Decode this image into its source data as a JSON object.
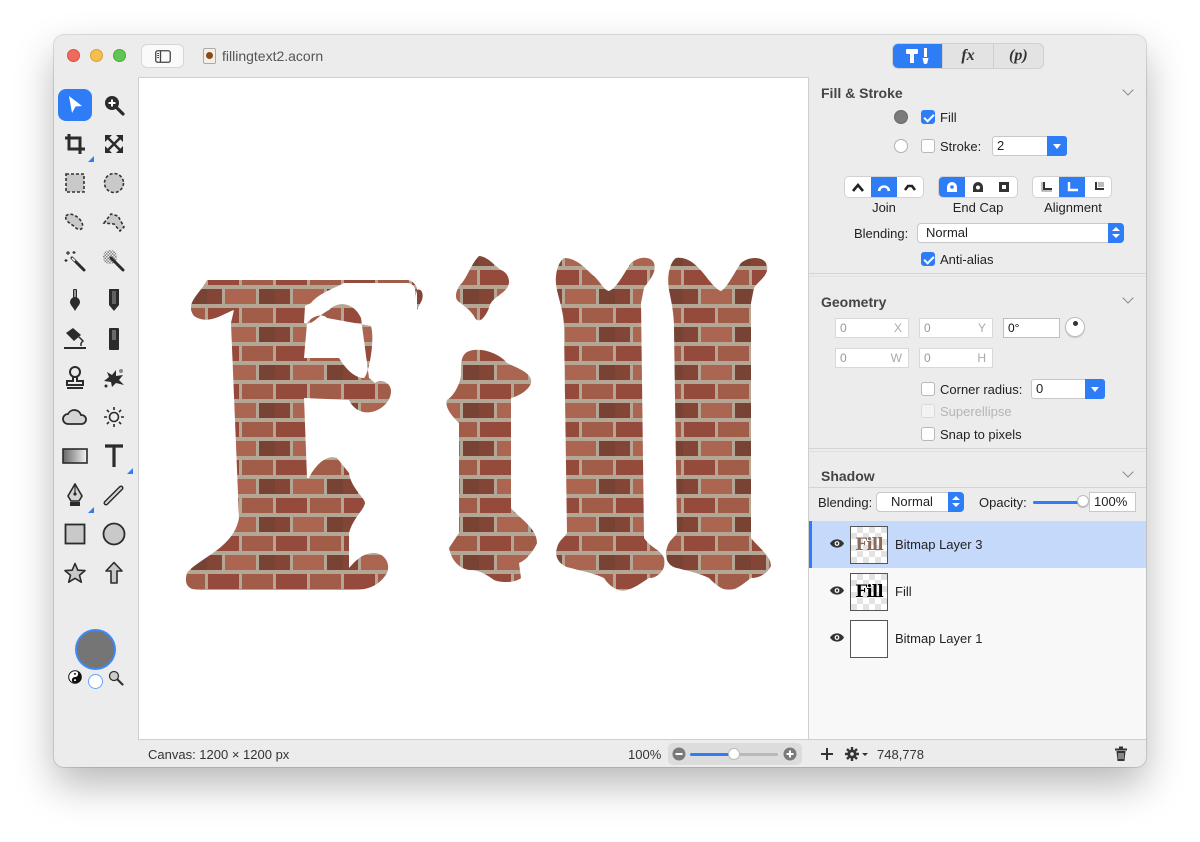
{
  "window": {
    "title": "fillingtext2.acorn",
    "inspector_tabs": [
      {
        "name": "tools",
        "icon": "hammer-brush-icon",
        "active": true
      },
      {
        "name": "filters",
        "label": "fx",
        "active": false
      },
      {
        "name": "properties",
        "label": "(p)",
        "active": false
      }
    ]
  },
  "toolbox": {
    "tools": [
      {
        "name": "select-tool",
        "icon": "arrow-pointer-icon",
        "active": true
      },
      {
        "name": "zoom-tool",
        "icon": "magnifier-plus-icon"
      },
      {
        "name": "crop-tool",
        "icon": "crop-icon"
      },
      {
        "name": "transform-tool",
        "icon": "expand-arrows-icon"
      },
      {
        "name": "rect-select-tool",
        "icon": "dashed-rect-icon"
      },
      {
        "name": "ellipse-select-tool",
        "icon": "dashed-circle-icon"
      },
      {
        "name": "lasso-tool",
        "icon": "lasso-icon"
      },
      {
        "name": "polygon-lasso-tool",
        "icon": "polygon-lasso-icon"
      },
      {
        "name": "magic-wand-tool",
        "icon": "magic-wand-icon"
      },
      {
        "name": "instant-alpha-tool",
        "icon": "instant-alpha-icon"
      },
      {
        "name": "brush-tool",
        "icon": "brush-icon"
      },
      {
        "name": "pencil-tool",
        "icon": "pencil-icon"
      },
      {
        "name": "paint-bucket-tool",
        "icon": "paint-bucket-icon"
      },
      {
        "name": "eraser-tool",
        "icon": "eraser-icon"
      },
      {
        "name": "clone-tool",
        "icon": "stamp-icon"
      },
      {
        "name": "smudge-tool",
        "icon": "splat-icon"
      },
      {
        "name": "blur-tool",
        "icon": "cloud-icon"
      },
      {
        "name": "dodge-tool",
        "icon": "sun-icon"
      },
      {
        "name": "gradient-tool",
        "icon": "gradient-icon"
      },
      {
        "name": "text-tool",
        "icon": "text-t-icon"
      },
      {
        "name": "pen-tool",
        "icon": "pen-nib-icon"
      },
      {
        "name": "line-tool",
        "icon": "line-icon"
      },
      {
        "name": "rectangle-tool",
        "icon": "rectangle-icon"
      },
      {
        "name": "oval-tool",
        "icon": "circle-icon"
      },
      {
        "name": "star-tool",
        "icon": "star-icon"
      },
      {
        "name": "arrow-tool",
        "icon": "up-arrow-icon"
      }
    ],
    "foreground_color": "#757575",
    "background_color": "#ffffff"
  },
  "canvas": {
    "text": "Fill",
    "texture": "brick",
    "brick_colors": [
      "#9b5040",
      "#a8624e",
      "#8a4a3a",
      "#b36a54",
      "#7e4638"
    ],
    "mortar_color": "#bcae9c"
  },
  "status": {
    "canvas_size": "Canvas: 1200 × 1200 px",
    "zoom_level": "100%",
    "zoom_slider_fraction": 0.5
  },
  "inspector": {
    "fill_stroke": {
      "title": "Fill & Stroke",
      "fill_label": "Fill",
      "fill_checked": true,
      "fill_color": "#7a7a7a",
      "stroke_label": "Stroke:",
      "stroke_checked": false,
      "stroke_color": "#ffffff",
      "stroke_width": "2",
      "join_label": "Join",
      "join_selected": 1,
      "endcap_label": "End Cap",
      "endcap_selected": 0,
      "alignment_label": "Alignment",
      "alignment_selected": 1,
      "blending_label": "Blending:",
      "blending_value": "Normal",
      "antialias_label": "Anti-alias",
      "antialias_checked": true
    },
    "geometry": {
      "title": "Geometry",
      "x_value": "0",
      "x_unit": "X",
      "y_value": "0",
      "y_unit": "Y",
      "angle_value": "0°",
      "w_value": "0",
      "w_unit": "W",
      "h_value": "0",
      "h_unit": "H",
      "corner_radius_label": "Corner radius:",
      "corner_radius_checked": false,
      "corner_radius_value": "0",
      "superellipse_label": "Superellipse",
      "superellipse_enabled": false,
      "snap_label": "Snap to pixels",
      "snap_checked": false
    },
    "shadow": {
      "title": "Shadow",
      "blending_label": "Blending:",
      "blending_value": "Normal",
      "opacity_label": "Opacity:",
      "opacity_value": "100%",
      "opacity_fraction": 1.0
    },
    "layers": [
      {
        "name": "Bitmap Layer 3",
        "visible": true,
        "selected": true,
        "thumb_text": "Fill",
        "thumb_color": "#8a6a58"
      },
      {
        "name": "Fill",
        "visible": true,
        "selected": false,
        "thumb_text": "Fill",
        "thumb_color": "#000000"
      },
      {
        "name": "Bitmap Layer 1",
        "visible": true,
        "selected": false,
        "thumb_text": "",
        "thumb_color": ""
      }
    ],
    "footer": {
      "coords": "748,778"
    }
  },
  "colors": {
    "accent": "#2e7cf6",
    "selection": "#c5d9fb",
    "window_bg": "#ececec"
  }
}
